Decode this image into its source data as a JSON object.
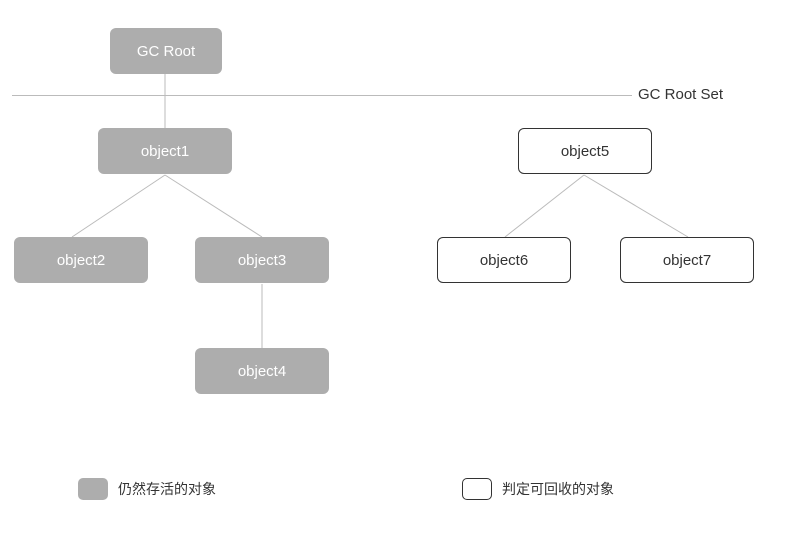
{
  "nodes": {
    "gcroot": "GC Root",
    "object1": "object1",
    "object2": "object2",
    "object3": "object3",
    "object4": "object4",
    "object5": "object5",
    "object6": "object6",
    "object7": "object7"
  },
  "divider_label": "GC Root Set",
  "legend": {
    "alive": "仍然存活的对象",
    "dead": "判定可回收的对象"
  },
  "chart_data": {
    "type": "diagram",
    "title": "GC Root Set",
    "trees": [
      {
        "root": "GC Root",
        "status": "alive",
        "children": [
          {
            "name": "object1",
            "status": "alive",
            "children": [
              {
                "name": "object2",
                "status": "alive",
                "children": []
              },
              {
                "name": "object3",
                "status": "alive",
                "children": [
                  {
                    "name": "object4",
                    "status": "alive",
                    "children": []
                  }
                ]
              }
            ]
          }
        ]
      },
      {
        "root": "object5",
        "status": "dead",
        "children": [
          {
            "name": "object6",
            "status": "dead",
            "children": []
          },
          {
            "name": "object7",
            "status": "dead",
            "children": []
          }
        ]
      }
    ],
    "legend": [
      {
        "swatch": "alive",
        "label": "仍然存活的对象"
      },
      {
        "swatch": "dead",
        "label": "判定可回收的对象"
      }
    ]
  }
}
